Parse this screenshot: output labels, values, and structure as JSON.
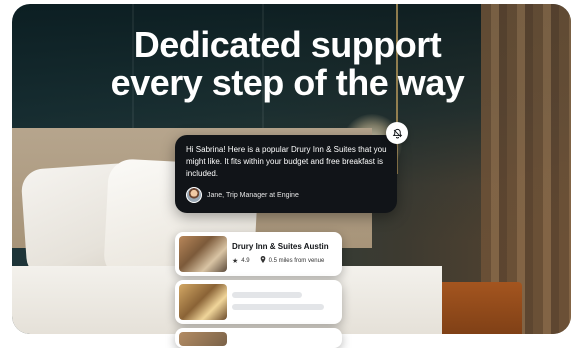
{
  "hero": {
    "headline_line1": "Dedicated support",
    "headline_line2": "every step of the way"
  },
  "chat": {
    "message": "Hi Sabrina! Here is a popular Drury Inn & Suites that you might like. It fits within your budget and free breakfast is included.",
    "sender": "Jane, Trip Manager at Engine",
    "notification_icon": "bell-off-icon"
  },
  "hotels": [
    {
      "name": "Drury Inn & Suites Austin",
      "rating": "4.9",
      "distance": "0.5 miles from venue"
    }
  ],
  "colors": {
    "chat_bg": "#111418",
    "card_bg": "#ffffff",
    "skeleton": "#e3e5e8"
  }
}
